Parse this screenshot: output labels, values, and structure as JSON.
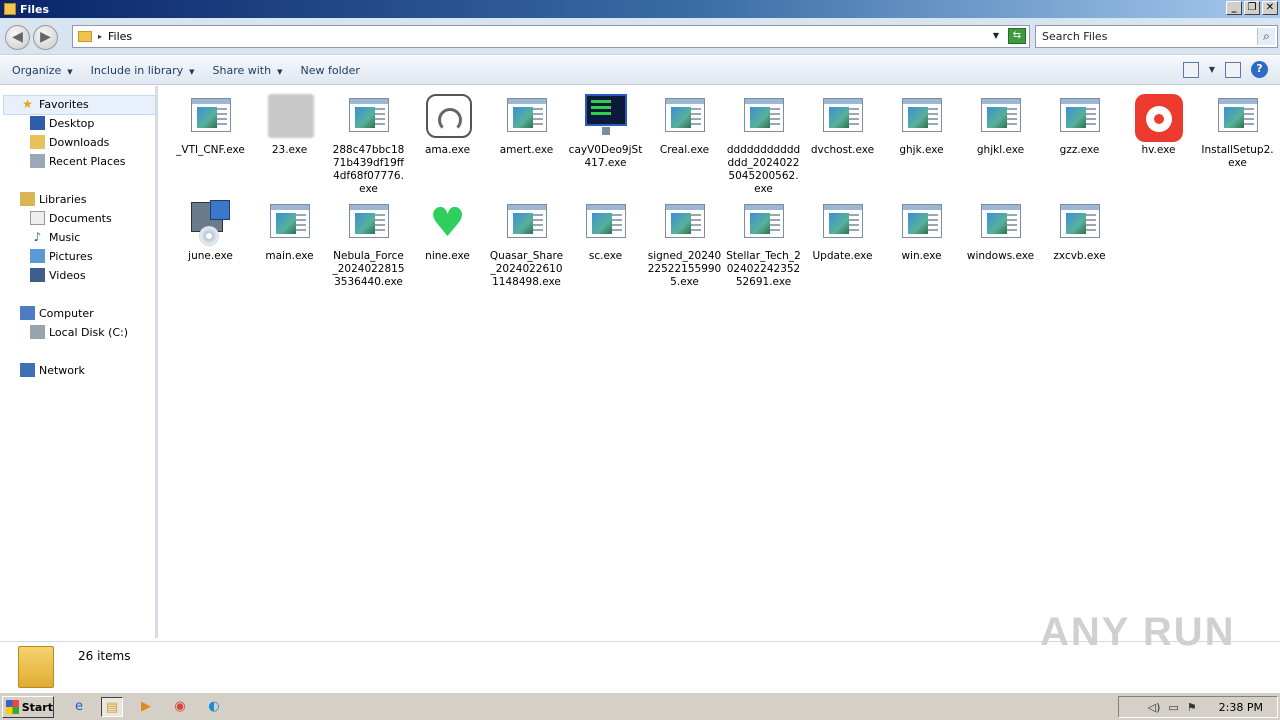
{
  "window": {
    "title": "Files",
    "controls": [
      "_",
      "❐",
      "✕"
    ]
  },
  "address": {
    "path": "Files",
    "search_placeholder": "Search Files"
  },
  "commands": {
    "organize": "Organize",
    "include": "Include in library",
    "share": "Share with",
    "new_folder": "New folder"
  },
  "nav": {
    "favorites": "Favorites",
    "desktop": "Desktop",
    "downloads": "Downloads",
    "recent": "Recent Places",
    "libraries": "Libraries",
    "documents": "Documents",
    "music": "Music",
    "pictures": "Pictures",
    "videos": "Videos",
    "computer": "Computer",
    "local_disk": "Local Disk (C:)",
    "network": "Network"
  },
  "files": [
    {
      "name": "_VTI_CNF.exe",
      "icon": "exe"
    },
    {
      "name": "23.exe",
      "icon": "blurred"
    },
    {
      "name": "288c47bbc1871b439df19ff4df68f07776.exe",
      "icon": "exe"
    },
    {
      "name": "ama.exe",
      "icon": "speedometer"
    },
    {
      "name": "amert.exe",
      "icon": "exe"
    },
    {
      "name": "cayV0Deo9jSt417.exe",
      "icon": "monitor"
    },
    {
      "name": "Creal.exe",
      "icon": "exe"
    },
    {
      "name": "dddddddddddddd_20240225045200562.exe",
      "icon": "exe"
    },
    {
      "name": "dvchost.exe",
      "icon": "exe"
    },
    {
      "name": "ghjk.exe",
      "icon": "exe"
    },
    {
      "name": "ghjkl.exe",
      "icon": "exe"
    },
    {
      "name": "gzz.exe",
      "icon": "exe"
    },
    {
      "name": "hv.exe",
      "icon": "red-app"
    },
    {
      "name": "InstallSetup2.exe",
      "icon": "exe"
    },
    {
      "name": "june.exe",
      "icon": "setup"
    },
    {
      "name": "main.exe",
      "icon": "exe"
    },
    {
      "name": "Nebula_Force_20240228153536440.exe",
      "icon": "exe"
    },
    {
      "name": "nine.exe",
      "icon": "heart"
    },
    {
      "name": "Quasar_Share_20240226101148498.exe",
      "icon": "exe"
    },
    {
      "name": "sc.exe",
      "icon": "exe"
    },
    {
      "name": "signed_20240225221559905.exe",
      "icon": "exe"
    },
    {
      "name": "Stellar_Tech_20240224235252691.exe",
      "icon": "exe"
    },
    {
      "name": "Update.exe",
      "icon": "exe"
    },
    {
      "name": "win.exe",
      "icon": "exe"
    },
    {
      "name": "windows.exe",
      "icon": "exe"
    },
    {
      "name": "zxcvb.exe",
      "icon": "exe"
    }
  ],
  "status": {
    "count": "26 items"
  },
  "watermark": "ANY RUN",
  "taskbar": {
    "start": "Start",
    "time": "2:38 PM"
  }
}
